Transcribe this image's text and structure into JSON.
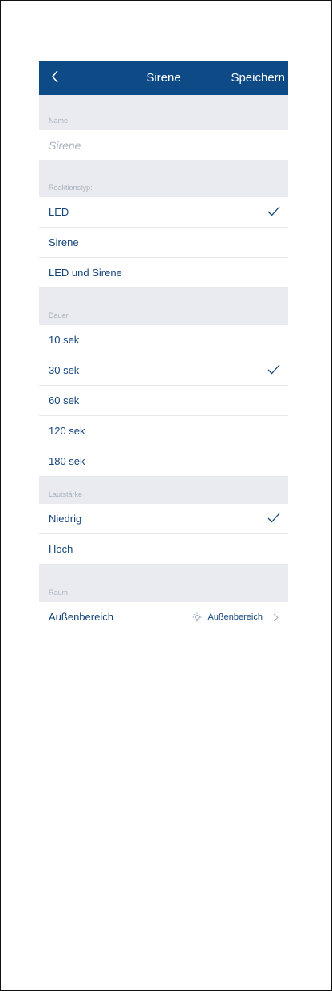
{
  "header": {
    "title": "Sirene",
    "save_label": "Speichern",
    "back_icon": "chevron-left-icon"
  },
  "name_section": {
    "label": "Name",
    "placeholder": "Sirene"
  },
  "reaction_section": {
    "label": "Reaktionstyp:",
    "options": [
      "LED",
      "Sirene",
      "LED und Sirene"
    ],
    "selected": "LED"
  },
  "duration_section": {
    "label": "Dauer",
    "options": [
      "10 sek",
      "30 sek",
      "60 sek",
      "120 sek",
      "180 sek"
    ],
    "selected": "30 sek"
  },
  "volume_section": {
    "label": "Lautstärke",
    "options": [
      "Niedrig",
      "Hoch"
    ],
    "selected": "Niedrig"
  },
  "room_section": {
    "label": "Raum",
    "item_label": "Außenbereich",
    "value": "Außenbereich",
    "value_icon": "sun-icon"
  },
  "colors": {
    "navbar": "#0e4a86",
    "accent_text": "#14447a",
    "section_bg": "#e9ebf0"
  }
}
